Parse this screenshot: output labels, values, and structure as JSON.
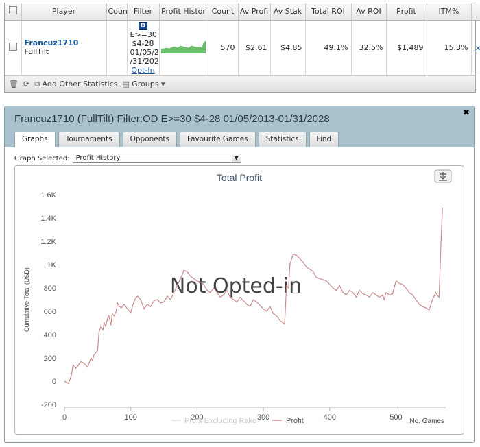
{
  "results": {
    "columns": [
      "Player",
      "Coun",
      "Filter",
      "Profit Histor",
      "Count",
      "Av Profi",
      "Av Stak",
      "Total ROI",
      "Av ROI",
      "Profit",
      "ITM%"
    ],
    "row": {
      "player": "Francuz1710",
      "site": "FullTilt",
      "country": "",
      "filter_badge": "D",
      "filter_lines": [
        "E>=30",
        "$4-28",
        "01/05/2",
        "/31/202"
      ],
      "filter_link": "Opt-In",
      "count": "570",
      "av_profit": "$2.61",
      "av_stake": "$4.85",
      "total_roi": "49.1%",
      "av_roi": "32.5%",
      "profit": "$1,489",
      "itm": "15.3%",
      "remove": "x"
    },
    "toolbar": {
      "delete_icon": "trash-icon",
      "refresh_icon": "refresh-icon",
      "add_stats": "Add Other Statistics",
      "groups": "Groups"
    }
  },
  "window": {
    "title": "Francuz1710 (FullTilt) Filter:OD E>=30 $4-28 01/05/2013-01/31/2028",
    "close": "✖",
    "tabs": [
      {
        "label": "Graphs",
        "active": true
      },
      {
        "label": "Tournaments"
      },
      {
        "label": "Opponents"
      },
      {
        "label": "Favourite Games"
      },
      {
        "label": "Statistics"
      },
      {
        "label": "Find"
      }
    ],
    "graph_select_label": "Graph Selected:",
    "graph_select_value": "Profit History"
  },
  "chart_data": {
    "type": "line",
    "title": "Total Profit",
    "ylabel": "Cumulative Total (USD)",
    "xlabel": "No. Games",
    "xlim": [
      0,
      575
    ],
    "ylim": [
      -200,
      1600
    ],
    "xticks": [
      0,
      100,
      200,
      300,
      400,
      500
    ],
    "yticks": [
      -200,
      0,
      200,
      400,
      600,
      800,
      1000,
      1200,
      1400,
      1600
    ],
    "ytick_labels": [
      "-200",
      "0",
      "200",
      "400",
      "600",
      "800",
      "1K",
      "1.2K",
      "1.4K",
      "1.6K"
    ],
    "watermark": "Not Opted-in",
    "series": [
      {
        "name": "Profit Excluding Rake",
        "color": "#dddddd",
        "values": []
      },
      {
        "name": "Profit",
        "color": "#c98b8b",
        "x": [
          0,
          3,
          6,
          10,
          13,
          17,
          20,
          25,
          30,
          35,
          40,
          42,
          45,
          50,
          52,
          55,
          58,
          60,
          62,
          65,
          67,
          70,
          72,
          75,
          78,
          80,
          83,
          86,
          90,
          95,
          100,
          103,
          107,
          110,
          115,
          120,
          125,
          130,
          135,
          140,
          145,
          150,
          155,
          160,
          165,
          170,
          175,
          180,
          185,
          190,
          195,
          200,
          205,
          210,
          215,
          220,
          225,
          230,
          235,
          240,
          245,
          250,
          255,
          260,
          265,
          270,
          275,
          280,
          285,
          290,
          295,
          300,
          305,
          310,
          315,
          320,
          325,
          330,
          332,
          335,
          338,
          340,
          342,
          345,
          350,
          355,
          360,
          365,
          370,
          375,
          380,
          385,
          390,
          395,
          400,
          405,
          410,
          415,
          420,
          425,
          430,
          435,
          440,
          445,
          450,
          455,
          460,
          465,
          470,
          475,
          480,
          482,
          485,
          490,
          495,
          500,
          505,
          510,
          515,
          520,
          525,
          530,
          535,
          540,
          545,
          550,
          555,
          560,
          562,
          565,
          568,
          570
        ],
        "values": [
          0,
          -10,
          -20,
          40,
          140,
          110,
          130,
          170,
          150,
          120,
          200,
          180,
          230,
          260,
          420,
          470,
          440,
          500,
          470,
          540,
          560,
          480,
          580,
          560,
          600,
          670,
          640,
          630,
          660,
          620,
          590,
          650,
          710,
          730,
          700,
          620,
          660,
          640,
          690,
          700,
          670,
          680,
          730,
          700,
          760,
          820,
          880,
          950,
          940,
          900,
          880,
          860,
          850,
          830,
          780,
          760,
          800,
          760,
          720,
          740,
          780,
          720,
          700,
          680,
          720,
          690,
          660,
          640,
          700,
          680,
          650,
          620,
          600,
          640,
          580,
          560,
          520,
          500,
          490,
          820,
          800,
          1000,
          1040,
          1090,
          1080,
          1050,
          1020,
          980,
          960,
          940,
          890,
          880,
          870,
          860,
          830,
          800,
          780,
          820,
          760,
          740,
          780,
          760,
          720,
          780,
          750,
          740,
          720,
          760,
          740,
          720,
          740,
          700,
          760,
          740,
          750,
          860,
          840,
          830,
          800,
          760,
          740,
          700,
          660,
          640,
          630,
          610,
          700,
          760,
          740,
          720,
          1200,
          1490
        ]
      }
    ],
    "legend_position": "bottom-center",
    "grid": false
  }
}
